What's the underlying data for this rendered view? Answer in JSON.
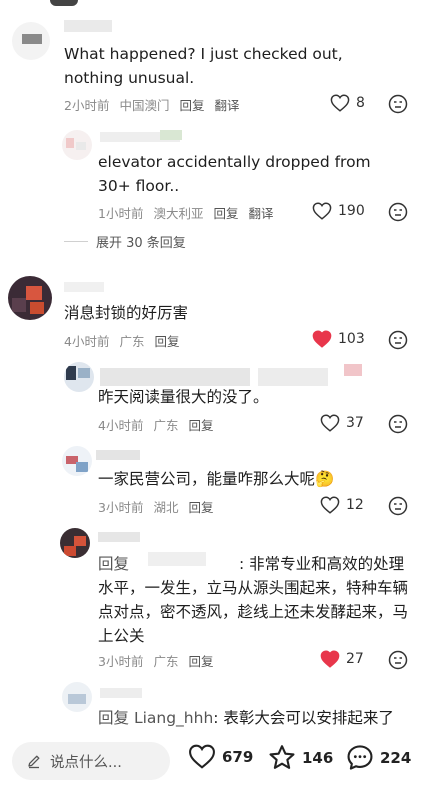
{
  "comments": [
    {
      "text": "What happened? I just checked out, nothing unusual.",
      "time": "2小时前",
      "location": "中国澳门",
      "reply": "回复",
      "translate": "翻译",
      "likes": "8",
      "liked": false
    },
    {
      "text": "elevator accidentally dropped from 30+ floor..",
      "time": "1小时前",
      "location": "澳大利亚",
      "reply": "回复",
      "translate": "翻译",
      "likes": "190",
      "liked": false
    },
    {
      "expand_label": "展开 30 条回复"
    },
    {
      "text": "消息封锁的好厉害",
      "time": "4小时前",
      "location": "广东",
      "reply": "回复",
      "likes": "103",
      "liked": true
    },
    {
      "text": "昨天阅读量很大的没了。",
      "time": "4小时前",
      "location": "广东",
      "reply": "回复",
      "likes": "37",
      "liked": false
    },
    {
      "text": "一家民营公司，能量咋那么大呢",
      "emoji": "🤔",
      "time": "3小时前",
      "location": "湖北",
      "reply": "回复",
      "likes": "12",
      "liked": false
    },
    {
      "prefix": "回复",
      "text": ": 非常专业和高效的处理水平，一发生，立马从源头围起来，特种车辆点对点，密不透风，趁线上还未发酵起来，马上公关",
      "time": "3小时前",
      "location": "广东",
      "reply": "回复",
      "likes": "27",
      "liked": true
    },
    {
      "prefix": "回复",
      "reply_to": "Liang_hhh",
      "text": ": 表彰大会可以安排起来了"
    }
  ],
  "bottombar": {
    "input_placeholder": "说点什么...",
    "likes": "679",
    "favorites": "146",
    "comments": "224"
  },
  "colors": {
    "liked": "#e8364b",
    "meta": "#8a8a8a"
  }
}
